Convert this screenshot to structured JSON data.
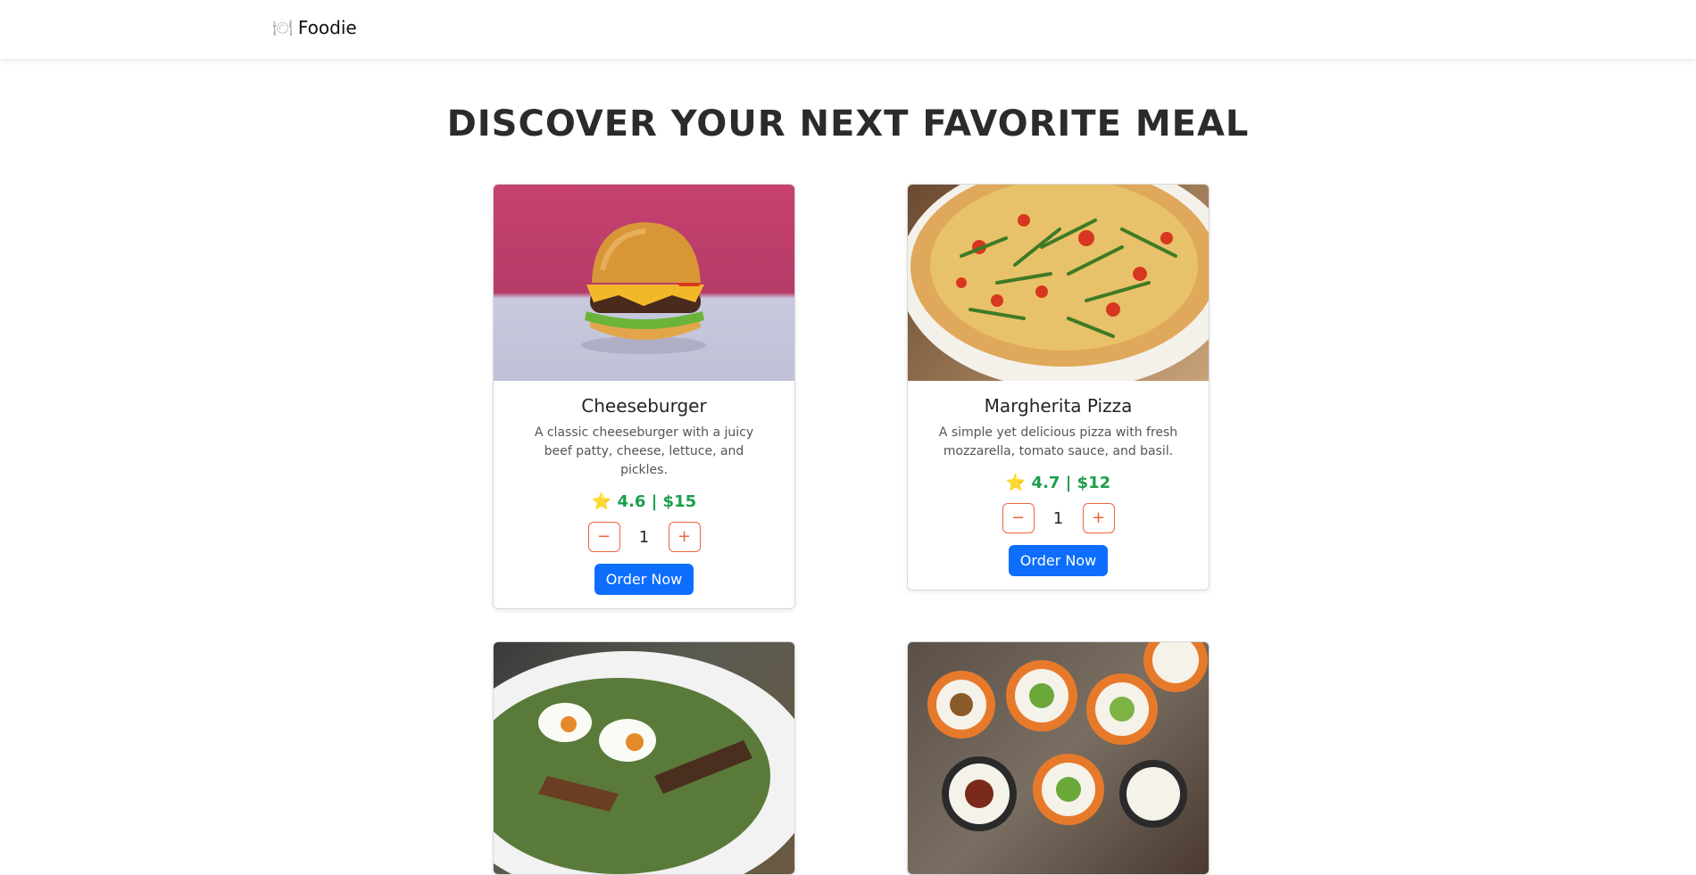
{
  "navbar": {
    "brand_icon": "plate-cutlery-icon",
    "brand_label": "Foodie"
  },
  "page": {
    "headline": "DISCOVER YOUR NEXT FAVORITE MEAL"
  },
  "cards": [
    {
      "title": "Cheeseburger",
      "description": "A classic cheeseburger with a juicy beef patty, cheese, lettuce, and pickles.",
      "rating": "4.6",
      "price": "$15",
      "meta": "⭐ 4.6 | $15",
      "quantity": "1",
      "decrement_label": "−",
      "increment_label": "+",
      "order_label": "Order Now"
    },
    {
      "title": "Margherita Pizza",
      "description": "A simple yet delicious pizza with fresh mozzarella, tomato sauce, and basil.",
      "rating": "4.7",
      "price": "$12",
      "meta": "⭐ 4.7 | $12",
      "quantity": "1",
      "decrement_label": "−",
      "increment_label": "+",
      "order_label": "Order Now"
    },
    {
      "image": "salad-photo"
    },
    {
      "image": "sushi-photo"
    }
  ],
  "colors": {
    "accent_primary": "#0d6efd",
    "stepper_border": "#f0643c",
    "meta_green": "#1e9e4b",
    "heading": "#2b2b2b"
  }
}
